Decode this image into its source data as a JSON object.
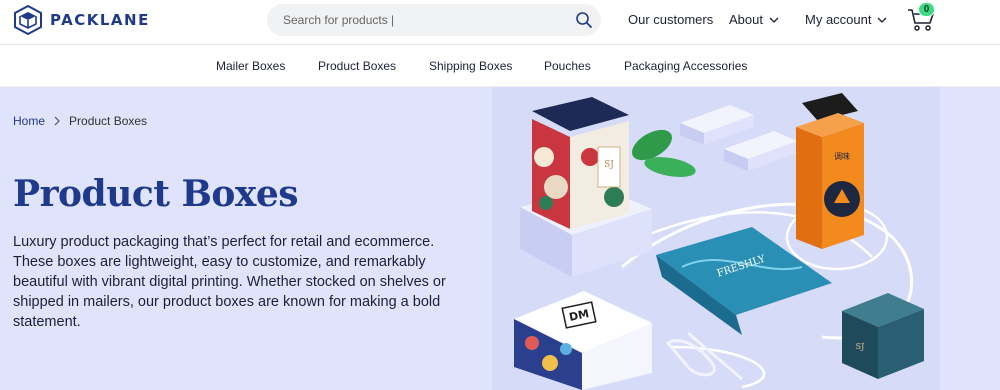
{
  "brand": {
    "name": "PACKLANE"
  },
  "search": {
    "placeholder": "Search for products |"
  },
  "top_nav": {
    "customers": "Our customers",
    "about": "About",
    "account": "My account"
  },
  "cart": {
    "count": "0"
  },
  "categories": [
    "Mailer Boxes",
    "Product Boxes",
    "Shipping Boxes",
    "Pouches",
    "Packaging Accessories"
  ],
  "breadcrumb": {
    "home": "Home",
    "current": "Product Boxes"
  },
  "hero": {
    "title": "Product Boxes",
    "description": "Luxury product packaging that’s perfect for retail and ecommerce. These boxes are lightweight, easy to customize, and remarkably beautiful with vibrant digital printing. Whether stocked on shelves or shipped in mailers, our product boxes are known for making a bold statement."
  },
  "image_labels": {
    "box_monogram": "SJ",
    "pouch_brand": "FRESHLY",
    "dm_logo": "DM",
    "orange_box_label": "调味"
  },
  "colors": {
    "brand_blue": "#1f3a8a",
    "hero_bg": "#dfe3fb",
    "cart_badge": "#3ddc84"
  }
}
